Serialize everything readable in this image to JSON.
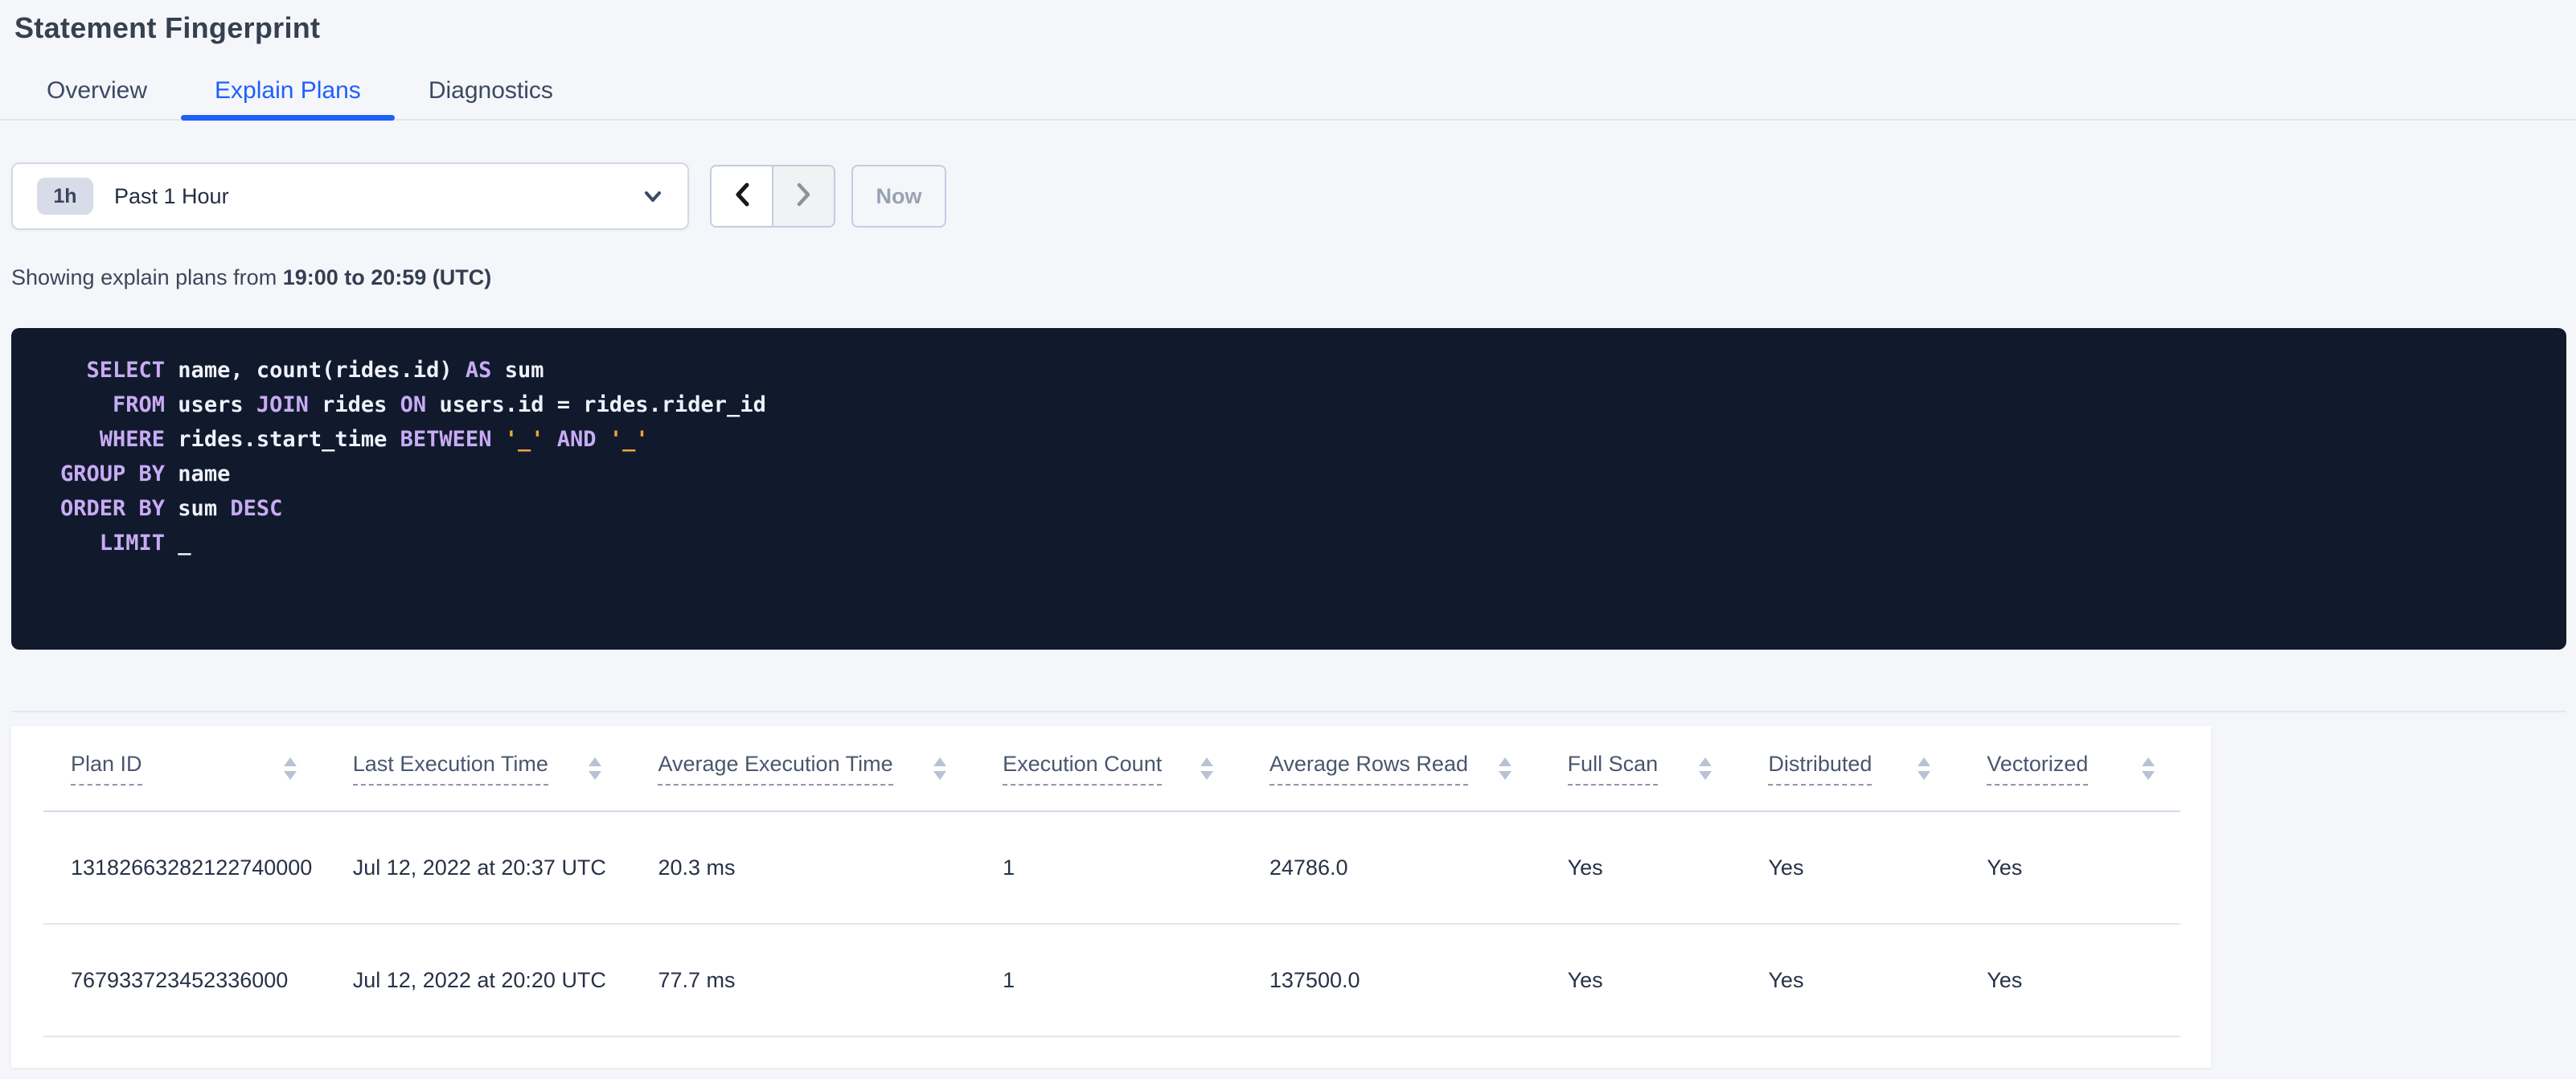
{
  "header": {
    "title": "Statement Fingerprint"
  },
  "tabs": [
    {
      "label": "Overview",
      "active": false
    },
    {
      "label": "Explain Plans",
      "active": true
    },
    {
      "label": "Diagnostics",
      "active": false
    }
  ],
  "time_selector": {
    "shortcut_badge": "1h",
    "selected_range": "Past 1 Hour",
    "now_label": "Now",
    "icons": {
      "dropdown": "chevron-down-icon",
      "prev": "chevron-left-icon",
      "next": "chevron-right-icon"
    }
  },
  "summary": {
    "prefix": "Showing explain plans from ",
    "range_bold": "19:00 to 20:59 (UTC)"
  },
  "sql": {
    "lines": [
      [
        [
          "kw",
          "  SELECT"
        ],
        [
          "id",
          " name, count(rides.id) "
        ],
        [
          "kw",
          "AS"
        ],
        [
          "id",
          " sum"
        ]
      ],
      [
        [
          "kw",
          "    FROM"
        ],
        [
          "id",
          " users "
        ],
        [
          "kw",
          "JOIN"
        ],
        [
          "id",
          " rides "
        ],
        [
          "kw",
          "ON"
        ],
        [
          "id",
          " users.id = rides.rider_id"
        ]
      ],
      [
        [
          "kw",
          "   WHERE"
        ],
        [
          "id",
          " rides.start_time "
        ],
        [
          "kw",
          "BETWEEN"
        ],
        [
          "id",
          " "
        ],
        [
          "lit",
          "'_'"
        ],
        [
          "id",
          " "
        ],
        [
          "kw",
          "AND"
        ],
        [
          "id",
          " "
        ],
        [
          "lit",
          "'_'"
        ]
      ],
      [
        [
          "kw",
          "GROUP BY"
        ],
        [
          "id",
          " name"
        ]
      ],
      [
        [
          "kw",
          "ORDER BY"
        ],
        [
          "id",
          " sum "
        ],
        [
          "kw",
          "DESC"
        ]
      ],
      [
        [
          "kw",
          "   LIMIT"
        ],
        [
          "id",
          " _"
        ]
      ]
    ]
  },
  "plans_table": {
    "columns": [
      {
        "label": "Plan ID"
      },
      {
        "label": "Last Execution Time"
      },
      {
        "label": "Average Execution Time"
      },
      {
        "label": "Execution Count"
      },
      {
        "label": "Average Rows Read"
      },
      {
        "label": "Full Scan"
      },
      {
        "label": "Distributed"
      },
      {
        "label": "Vectorized"
      }
    ],
    "sort_icon": "sort-arrows-icon",
    "rows": [
      [
        "13182663282122740000",
        "Jul 12, 2022 at 20:37 UTC",
        "20.3 ms",
        "1",
        "24786.0",
        "Yes",
        "Yes",
        "Yes"
      ],
      [
        "767933723452336000",
        "Jul 12, 2022 at 20:20 UTC",
        "77.7 ms",
        "1",
        "137500.0",
        "Yes",
        "Yes",
        "Yes"
      ]
    ]
  },
  "colors": {
    "accent_blue": "#2060fa",
    "sql_background": "#101a2c",
    "sql_keyword": "#c8abf5",
    "sql_text": "#eef1fb",
    "sql_literal": "#f0a43c"
  }
}
